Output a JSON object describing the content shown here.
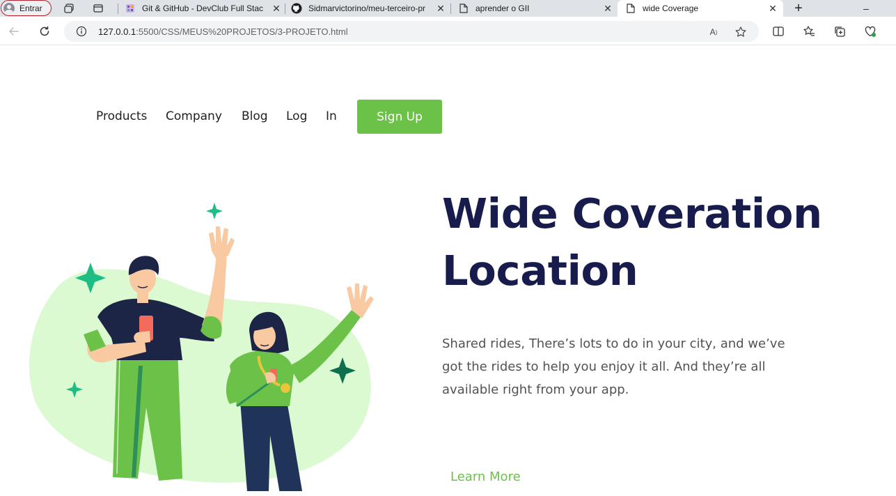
{
  "browser": {
    "profile_label": "Entrar",
    "tabs": [
      {
        "title": "Git & GitHub - DevClub Full Stac",
        "active": false
      },
      {
        "title": "Sidmarvictorino/meu-terceiro-pr",
        "active": false
      },
      {
        "title": "aprender o GII",
        "active": false
      },
      {
        "title": "wide Coverage",
        "active": true
      }
    ],
    "url_host": "127.0.0.1",
    "url_rest": ":5500/CSS/MEUS%20PROJETOS/3-PROJETO.html",
    "window_controls": {
      "minimize": "–",
      "maximize": "□",
      "close": "✕"
    }
  },
  "nav": {
    "links": [
      "Products",
      "Company",
      "Blog",
      "Log",
      "In"
    ],
    "signup_label": "Sign Up"
  },
  "hero": {
    "title_line1": "Wide Coveration",
    "title_line2": "Location",
    "text": "Shared rides, There’s lots to do in your city, and we’ve got the rides to help you enjoy it all. And they’re all available right from your app.",
    "learn_more": "Learn More"
  },
  "colors": {
    "accent_green": "#6cc148",
    "title_navy": "#181c4d",
    "blob_green": "#dcfad2",
    "sparkle_teal": "#1ebd84"
  }
}
